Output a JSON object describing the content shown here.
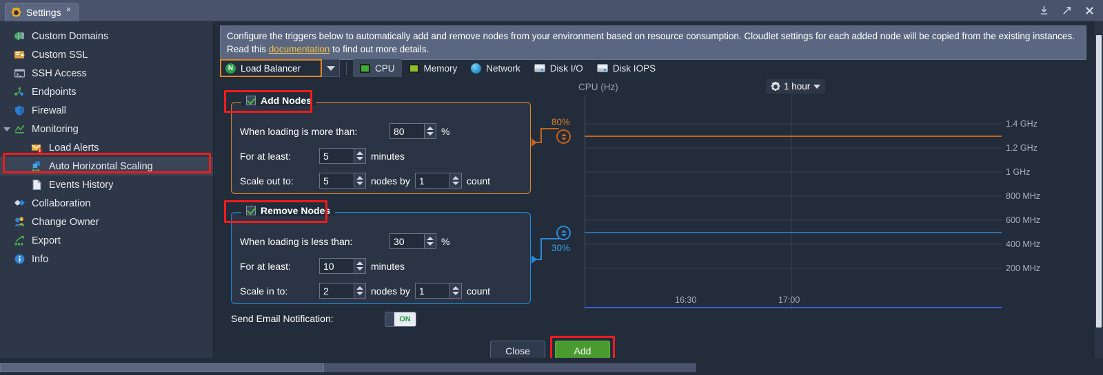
{
  "window": {
    "tab_title": "Settings",
    "tab_close": "×",
    "controls": [
      "minimize-icon",
      "maximize-icon",
      "close-icon"
    ]
  },
  "sidebar": {
    "items": [
      {
        "label": "Custom Domains",
        "icon": "globe-domains-icon",
        "indent": false,
        "selected": false
      },
      {
        "label": "Custom SSL",
        "icon": "certificate-icon",
        "indent": false,
        "selected": false
      },
      {
        "label": "SSH Access",
        "icon": "terminal-icon",
        "indent": false,
        "selected": false
      },
      {
        "label": "Endpoints",
        "icon": "endpoints-icon",
        "indent": false,
        "selected": false
      },
      {
        "label": "Firewall",
        "icon": "shield-icon",
        "indent": false,
        "selected": false
      },
      {
        "label": "Monitoring",
        "icon": "chart-icon",
        "indent": false,
        "selected": false,
        "expandable": true
      },
      {
        "label": "Load Alerts",
        "icon": "envelope-alert-icon",
        "indent": true,
        "selected": false
      },
      {
        "label": "Auto Horizontal Scaling",
        "icon": "scaling-icon",
        "indent": true,
        "selected": true
      },
      {
        "label": "Events History",
        "icon": "document-icon",
        "indent": true,
        "selected": false
      },
      {
        "label": "Collaboration",
        "icon": "handshake-icon",
        "indent": false,
        "selected": false
      },
      {
        "label": "Change Owner",
        "icon": "users-icon",
        "indent": false,
        "selected": false
      },
      {
        "label": "Export",
        "icon": "export-icon",
        "indent": false,
        "selected": false
      },
      {
        "label": "Info",
        "icon": "info-icon",
        "indent": false,
        "selected": false
      }
    ]
  },
  "notice": {
    "line1_a": "Configure the triggers below to automatically add and remove nodes from your environment based on resource consumption. Cloudlet settings for each added node will be copied from the existing instances.",
    "line2_a": "Read this ",
    "link": "documentation",
    "line2_b": " to find out more details."
  },
  "toolbar": {
    "node_group": "Load Balancer",
    "node_group_icon": "nginx-icon",
    "metrics": [
      {
        "label": "CPU",
        "icon": "cpu-chip-icon",
        "active": true
      },
      {
        "label": "Memory",
        "icon": "memory-chip-icon",
        "active": false
      },
      {
        "label": "Network",
        "icon": "globe-network-icon",
        "active": false
      },
      {
        "label": "Disk I/O",
        "icon": "disk-icon",
        "active": false
      },
      {
        "label": "Disk IOPS",
        "icon": "disk-icon",
        "active": false
      }
    ]
  },
  "add_nodes": {
    "title": "Add Nodes",
    "checked": true,
    "accent": "#e08a28",
    "condition_label": "When loading is more than:",
    "condition_value": "80",
    "condition_unit": "%",
    "duration_label": "For at least:",
    "duration_value": "5",
    "duration_unit": "minutes",
    "scale_label": "Scale out to:",
    "scale_value": "5",
    "scale_mid": "nodes by",
    "step_value": "1",
    "step_unit": "count"
  },
  "remove_nodes": {
    "title": "Remove Nodes",
    "checked": true,
    "accent": "#1f90e0",
    "condition_label": "When loading is less than:",
    "condition_value": "30",
    "condition_unit": "%",
    "duration_label": "For at least:",
    "duration_value": "10",
    "duration_unit": "minutes",
    "scale_label": "Scale in to:",
    "scale_value": "2",
    "scale_mid": "nodes by",
    "step_value": "1",
    "step_unit": "count"
  },
  "footer": {
    "email_label": "Send Email Notification:",
    "email_state": "ON",
    "close_label": "Close",
    "add_label": "Add"
  },
  "chart_data": {
    "type": "line",
    "title": "CPU (Hz)",
    "period": "1 hour",
    "xlabel": "",
    "ylabel": "CPU (Hz)",
    "yticks": [
      "1.4 GHz",
      "1.2 GHz",
      "1 GHz",
      "800 MHz",
      "600 MHz",
      "400 MHz",
      "200 MHz"
    ],
    "ytick_values": [
      1400,
      1200,
      1000,
      800,
      600,
      400,
      200
    ],
    "ylim": [
      0,
      1500
    ],
    "xticks": [
      "16:30",
      "17:00"
    ],
    "grid": true,
    "legend": "none",
    "series": [
      {
        "name": "Add Nodes threshold",
        "type": "threshold-line",
        "label": "80%",
        "value_pct": 80,
        "value_hz": 1200,
        "color": "#c4641e"
      },
      {
        "name": "Remove Nodes threshold",
        "type": "threshold-line",
        "label": "30%",
        "value_pct": 30,
        "value_hz": 450,
        "color": "#2c8ad8"
      },
      {
        "name": "CPU usage",
        "type": "line",
        "color": "#3a5fd9",
        "values": [
          0,
          0,
          0,
          0,
          0,
          0,
          0,
          0,
          0,
          0
        ]
      }
    ]
  }
}
